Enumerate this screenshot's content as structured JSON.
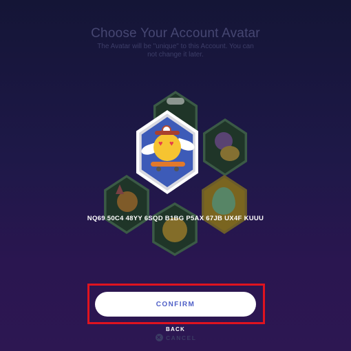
{
  "header": {
    "title": "Choose Your Account Avatar",
    "subtitle": "The Avatar will be \"unique\" to this Account. You can not change it later."
  },
  "avatars": {
    "selected": "winged-heart-eyes-skateboard-avatar",
    "options": [
      "chef-hat-avatar",
      "purple-creature-avatar",
      "droplet-avatar",
      "dizzy-face-avatar",
      "party-hat-avatar",
      "winged-heart-eyes-skateboard-avatar"
    ]
  },
  "account_code": "NQ69 50C4 48YY 6SQD B1BG P5AX 67JB UX4F KUUU",
  "actions": {
    "confirm_label": "CONFIRM",
    "back_label": "BACK",
    "cancel_label": "CANCEL"
  },
  "colors": {
    "accent": "#4e5fc7",
    "highlight_border": "#e0131f",
    "main_hex_bg": "#3d5bb8"
  }
}
